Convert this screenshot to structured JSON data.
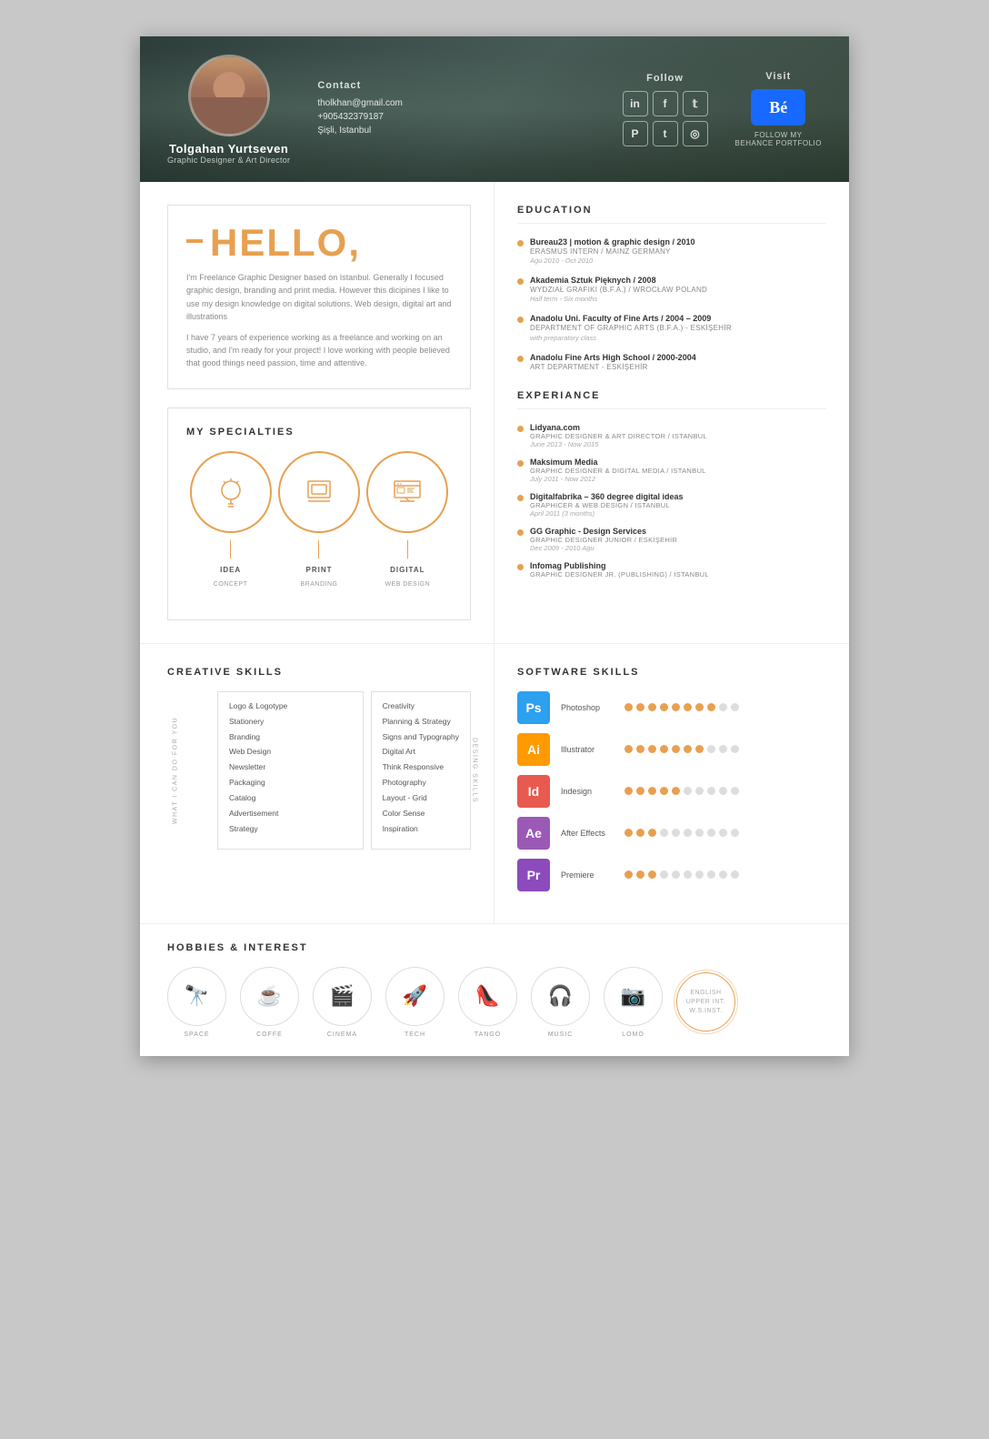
{
  "header": {
    "name": "Tolgahan Yurtseven",
    "title": "Graphic Designer & Art Director",
    "contact_label": "Contact",
    "email": "tholkhan@gmail.com",
    "phone": "+905432379187",
    "location": "Şişli, Istanbul",
    "follow_label": "Follow",
    "social_icons": [
      "in",
      "f",
      "t",
      "P",
      "t",
      "◎"
    ],
    "visit_label": "Visit",
    "behance_text": "FOLLOW MY\nBEHANCE PORTFOLIO"
  },
  "hello": {
    "greeting": "HELLO,",
    "bio1": "I'm Freelance Graphic Designer based on Istanbul. Generally I focused graphic design, branding and print media. However this dicipines I like to use my design knowledge on digital solutions. Web design, digital art and illustrations",
    "bio2": "I have 7 years of experience working as a freelance and working on an studio, and I'm ready for your project! I love working with people believed that good things need passion, time and attentive."
  },
  "specialties": {
    "title": "MY SPECIALTIES",
    "items": [
      {
        "icon": "💡",
        "label": "IDEA",
        "sublabel": "CONCEPT"
      },
      {
        "icon": "🖨",
        "label": "PRINT",
        "sublabel": "BRANDING"
      },
      {
        "icon": "🖥",
        "label": "DIGITAL",
        "sublabel": "WEB DESIGN"
      }
    ]
  },
  "education": {
    "title": "EDUCATION",
    "items": [
      {
        "name": "Bureau23 | motion & graphic design / 2010",
        "sub": "ERASMUS INTERN / MAINZ GERMANY",
        "date": "Agu 2010 - Oct 2010"
      },
      {
        "name": "Akademia Sztuk Pięknych / 2008",
        "sub": "WYDZIAŁ GRAFIKI (B.F.A.) / WROCŁAW POLAND",
        "date": "Half term - Six months"
      },
      {
        "name": "Anadolu Uni. Faculty of Fine Arts / 2004 – 2009",
        "sub": "DEPARTMENT OF GRAPHIC ARTS (B.F.A.) - ESKİŞEHİR",
        "date": "with preparatory class"
      },
      {
        "name": "Anadolu Fine Arts High School / 2000-2004",
        "sub": "ART DEPARTMENT - ESKİŞEHİR",
        "date": ""
      }
    ]
  },
  "experience": {
    "title": "EXPERIANCE",
    "items": [
      {
        "name": "Lidyana.com",
        "sub": "GRAPHIC DESIGNER & ART DIRECTOR / ISTANBUL",
        "date": "June 2013 - Now 2015"
      },
      {
        "name": "Maksimum Media",
        "sub": "GRAPHIC DESIGNER & DIGITAL MEDIA / ISTANBUL",
        "date": "July 2011 - Now 2012"
      },
      {
        "name": "Digitalfabrika – 360 degree digital ideas",
        "sub": "GRAPHICER & WEB DESIGN / ISTANBUL",
        "date": "April 2011 (3 months)"
      },
      {
        "name": "GG Graphic - Design Services",
        "sub": "GRAPHIC DESIGNER JUNIOR / ESKİŞEHİR",
        "date": "Dec 2009 - 2010 Agu"
      },
      {
        "name": "Infomag Publishing",
        "sub": "GRAPHIC DESIGNER JR. (PUBLISHING) / ISTANBUL",
        "date": ""
      }
    ]
  },
  "creative_skills": {
    "title": "CREATIVE SKILLS",
    "what_i_can_label": "WHAT I CAN DO FOR YOU",
    "desing_skills_label": "DESING SKILLS",
    "col1": [
      "Logo & Logotype",
      "Stationery",
      "Branding",
      "Web Design",
      "Newsletter",
      "Packaging",
      "Catalog",
      "Advertisement",
      "Strategy"
    ],
    "col2": [
      "Creativity",
      "Planning & Strategy",
      "Signs and Typography",
      "Digital Art",
      "Think Responsive",
      "Photography",
      "Layout - Grid",
      "Color Sense",
      "Inspiration"
    ]
  },
  "software_skills": {
    "title": "SOFTWARE SKILLS",
    "items": [
      {
        "name": "Photoshop",
        "abbr": "Ps",
        "class": "sw-ps",
        "filled": 8,
        "empty": 2
      },
      {
        "name": "Illustrator",
        "abbr": "Ai",
        "class": "sw-ai",
        "filled": 7,
        "empty": 3
      },
      {
        "name": "Indesign",
        "abbr": "Id",
        "class": "sw-id",
        "filled": 5,
        "empty": 5
      },
      {
        "name": "After Effects",
        "abbr": "Ae",
        "class": "sw-ae",
        "filled": 3,
        "empty": 7
      },
      {
        "name": "Premiere",
        "abbr": "Pr",
        "class": "sw-pr",
        "filled": 3,
        "empty": 7
      }
    ]
  },
  "hobbies": {
    "title": "HOBBIES & INTEREST",
    "items": [
      {
        "icon": "🔭",
        "label": "SPACE"
      },
      {
        "icon": "☕",
        "label": "COFFE"
      },
      {
        "icon": "🎬",
        "label": "CINEMA"
      },
      {
        "icon": "🚀",
        "label": "TECH"
      },
      {
        "icon": "👠",
        "label": "TANGO"
      },
      {
        "icon": "🎧",
        "label": "MUSIC"
      },
      {
        "icon": "📷",
        "label": "LOMO"
      }
    ],
    "language": "ENGLISH\nUPPER INT.\nW.S.INST."
  }
}
